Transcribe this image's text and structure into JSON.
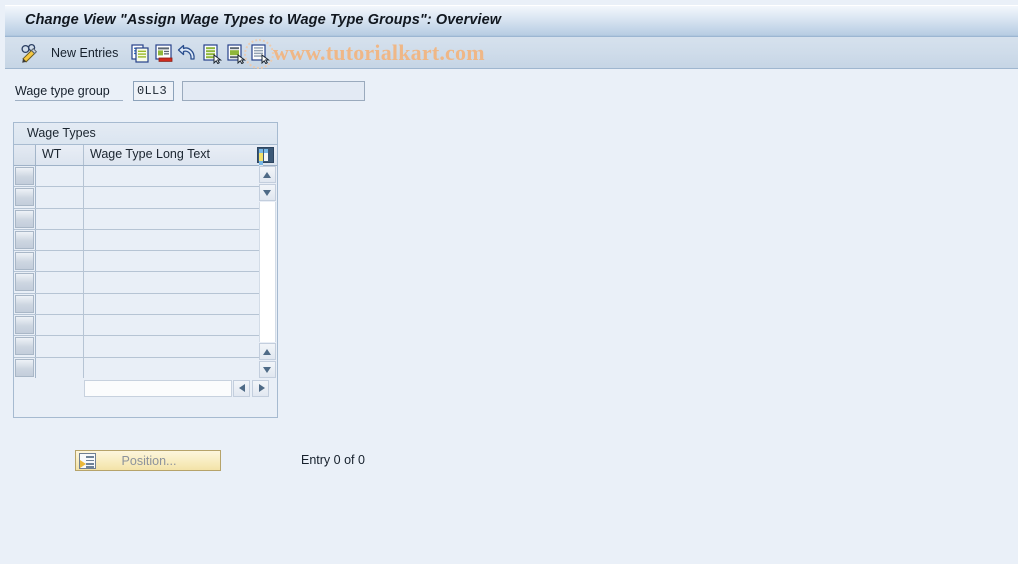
{
  "window": {
    "title": "Change View \"Assign Wage Types to Wage Type Groups\": Overview"
  },
  "toolbar": {
    "display_change_icon": "pencil-glasses-icon",
    "new_entries_label": "New Entries",
    "buttons": [
      {
        "name": "copy-as-button",
        "icon": "copy-documents-icon"
      },
      {
        "name": "delete-button",
        "icon": "document-delete-icon"
      },
      {
        "name": "undo-button",
        "icon": "undo-arrow-icon"
      },
      {
        "name": "select-all-button",
        "icon": "document-select-all-icon"
      },
      {
        "name": "select-block-button",
        "icon": "document-select-block-icon"
      },
      {
        "name": "deselect-all-button",
        "icon": "document-deselect-icon"
      }
    ],
    "watermark": "www.tutorialkart.com"
  },
  "form": {
    "wage_type_group_label": "Wage type group",
    "wage_type_group_key": "0LL3",
    "wage_type_group_text": "",
    "wage_type_group_text_placeholder": ""
  },
  "table": {
    "caption": "Wage Types",
    "columns": [
      {
        "key": "select",
        "label": ""
      },
      {
        "key": "wt",
        "label": "WT"
      },
      {
        "key": "long_text",
        "label": "Wage Type Long Text"
      }
    ],
    "column_config_icon": "table-settings-icon",
    "rows": [
      {
        "wt": "",
        "long_text": ""
      },
      {
        "wt": "",
        "long_text": ""
      },
      {
        "wt": "",
        "long_text": ""
      },
      {
        "wt": "",
        "long_text": ""
      },
      {
        "wt": "",
        "long_text": ""
      },
      {
        "wt": "",
        "long_text": ""
      },
      {
        "wt": "",
        "long_text": ""
      },
      {
        "wt": "",
        "long_text": ""
      },
      {
        "wt": "",
        "long_text": ""
      },
      {
        "wt": "",
        "long_text": ""
      }
    ],
    "scroll": {
      "up_icon": "scroll-up-icon",
      "down_icon": "scroll-down-icon",
      "left_icon": "scroll-left-icon",
      "right_icon": "scroll-right-icon"
    }
  },
  "footer": {
    "position_button_label": "Position...",
    "position_button_icon": "position-list-icon",
    "entry_count": "Entry 0 of 0"
  },
  "colors": {
    "title_gradient_top": "#f3f7fc",
    "title_gradient_bottom": "#a9c1db",
    "toolbar_bg": "#cfdcea",
    "content_bg": "#eaf0f8",
    "table_bg": "#e9eff7",
    "watermark": "#efb787",
    "position_button": "#f8ecc0",
    "accent_border": "#a6bad0"
  }
}
